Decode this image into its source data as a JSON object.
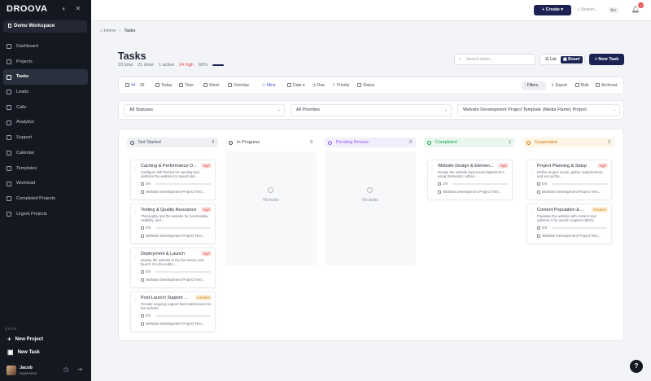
{
  "app": {
    "logo": "DROOVA",
    "workspace": "Demo Workspace"
  },
  "sidebar": {
    "items": [
      {
        "label": "Dashboard"
      },
      {
        "label": "Projects"
      },
      {
        "label": "Tasks"
      },
      {
        "label": "Leads"
      },
      {
        "label": "Calls"
      },
      {
        "label": "Analytics"
      },
      {
        "label": "Support"
      },
      {
        "label": "Calendar"
      },
      {
        "label": "Templates"
      },
      {
        "label": "Workload"
      },
      {
        "label": "Completed Projects"
      },
      {
        "label": "Urgent Projects"
      }
    ],
    "active_index": 2,
    "quick_label": "QUICK",
    "quick_new_project": "New Project",
    "quick_new_task": "New Task",
    "user_name": "Jacob",
    "user_role": "Supervisor"
  },
  "topbar": {
    "create_label": "Create",
    "search_label": "Search...",
    "search_shortcut": "⌘K",
    "notification_count": "12"
  },
  "breadcrumb": {
    "home": "Home",
    "current": "Tasks"
  },
  "page": {
    "title": "Tasks",
    "total": "33 total",
    "done": "21 done",
    "active": "1 active",
    "high": "24 high",
    "percent": "60%",
    "progress": 0.6,
    "search_placeholder": "Search tasks...",
    "view_list": "List",
    "view_board": "Board",
    "new_task": "New Task"
  },
  "filterbar": {
    "all_count": "44",
    "mine_count": "35",
    "today": "Today",
    "time": "Time",
    "week": "Week",
    "overdue": "Overdue",
    "mine": "Mine",
    "date": "Date",
    "due": "Due",
    "priority": "Priority",
    "status": "Status",
    "filters": "Filters",
    "export": "Export",
    "bulk": "Bulk",
    "archived": "Archived"
  },
  "selects": {
    "status": "All Statuses",
    "priority": "All Priorities",
    "project": "Website Development Project Template (Media Flame) Project"
  },
  "columns": [
    {
      "name": "Not Started",
      "count": "4",
      "color": "#4b5160",
      "bg": "#eef0f3",
      "cards": [
        {
          "title": "Caching & Performance O...",
          "priority": "high",
          "desc": "Configure WP Rocket for caching and optimize the website for speed and...",
          "subtasks": "0/4",
          "project": "Website Development Project Tem..."
        },
        {
          "title": "Testing & Quality Assurance",
          "priority": "high",
          "desc": "Thoroughly test the website for functionality, usability, and...",
          "subtasks": "0/4",
          "project": "Website Development Project Tem..."
        },
        {
          "title": "Deployment & Launch",
          "priority": "high",
          "desc": "Deploy the website to the live server and launch it to the public....",
          "subtasks": "0/4",
          "project": "Website Development Project Tem..."
        },
        {
          "title": "Post-Launch Support ...",
          "priority": "medium",
          "desc": "Provide ongoing support and maintenance for the website.",
          "subtasks": "0/4",
          "project": "Website Development Project Tem..."
        }
      ]
    },
    {
      "name": "In Progress",
      "count": "0",
      "color": "#3b4150",
      "bg": "#ffffff",
      "empty_text": "No tasks",
      "cards": []
    },
    {
      "name": "Pending Review",
      "count": "0",
      "color": "#8b5cf6",
      "bg": "#f3eefe",
      "empty_text": "No tasks",
      "cards": []
    },
    {
      "name": "Completed",
      "count": "1",
      "color": "#16a34a",
      "bg": "#eaf7ee",
      "cards": [
        {
          "title": "Website Design & Elemen...",
          "priority": "high",
          "desc": "Design the website layout and implement it using Elementor, adheri...",
          "subtasks": "2/4",
          "project": "Website Development Project Tem..."
        }
      ]
    },
    {
      "name": "Suspended",
      "count": "2",
      "color": "#d97706",
      "bg": "#fdf5e6",
      "cards": [
        {
          "title": "Project Planning & Setup",
          "priority": "high",
          "desc": "Define project scope, gather requirements, and set up the...",
          "subtasks": "0/4",
          "project": "Website Development Project Tem..."
        },
        {
          "title": "Content Population & ...",
          "priority": "medium",
          "desc": "Populate the website with content and optimize it for search engines (SEO).",
          "subtasks": "0/4",
          "project": "Website Development Project Tem..."
        }
      ]
    }
  ],
  "help_label": "?"
}
